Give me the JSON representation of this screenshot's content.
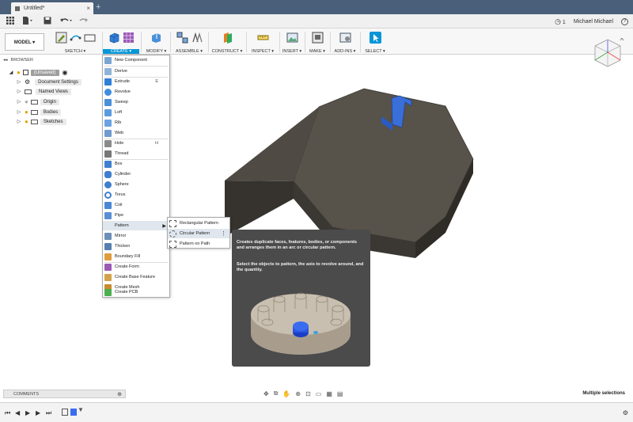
{
  "window": {
    "doc_tab": "Untitled*",
    "new_tab": "+"
  },
  "quickbar": {
    "jobs_count": "1",
    "user": "Michael Michael",
    "help": "?"
  },
  "ribbon": {
    "model": "MODEL ▾",
    "groups": [
      "SKETCH ▾",
      "CREATE ▾",
      "MODIFY ▾",
      "ASSEMBLE ▾",
      "CONSTRUCT ▾",
      "INSPECT ▾",
      "INSERT ▾",
      "MAKE ▾",
      "ADD-INS ▾",
      "SELECT ▾"
    ]
  },
  "browser": {
    "title": "BROWSER",
    "root": "(Unsaved)",
    "items": [
      "Document Settings",
      "Named Views",
      "Origin",
      "Bodies",
      "Sketches"
    ]
  },
  "create_menu": {
    "items": [
      {
        "label": "New Component",
        "shortcut": ""
      },
      {
        "label": "Derive",
        "shortcut": ""
      },
      {
        "label": "Extrude",
        "shortcut": "E"
      },
      {
        "label": "Revolve",
        "shortcut": ""
      },
      {
        "label": "Sweep",
        "shortcut": ""
      },
      {
        "label": "Loft",
        "shortcut": ""
      },
      {
        "label": "Rib",
        "shortcut": ""
      },
      {
        "label": "Web",
        "shortcut": ""
      },
      {
        "label": "Hole",
        "shortcut": "H"
      },
      {
        "label": "Thread",
        "shortcut": ""
      },
      {
        "label": "Box",
        "shortcut": ""
      },
      {
        "label": "Cylinder",
        "shortcut": ""
      },
      {
        "label": "Sphere",
        "shortcut": ""
      },
      {
        "label": "Torus",
        "shortcut": ""
      },
      {
        "label": "Coil",
        "shortcut": ""
      },
      {
        "label": "Pipe",
        "shortcut": ""
      },
      {
        "label": "Pattern",
        "shortcut": ""
      },
      {
        "label": "Mirror",
        "shortcut": ""
      },
      {
        "label": "Thicken",
        "shortcut": ""
      },
      {
        "label": "Boundary Fill",
        "shortcut": ""
      },
      {
        "label": "Create Form",
        "shortcut": ""
      },
      {
        "label": "Create Base Feature",
        "shortcut": ""
      },
      {
        "label": "Create Mesh",
        "shortcut": ""
      },
      {
        "label": "Create PCB",
        "shortcut": ""
      }
    ]
  },
  "pattern_submenu": {
    "items": [
      "Rectangular Pattern",
      "Circular Pattern",
      "Pattern on Path"
    ]
  },
  "tooltip": {
    "line1": "Creates duplicate faces, features, bodies, or components and arranges them in an arc or circular pattern.",
    "line2": "Select the objects to pattern, the axis to revolve around, and the quantity."
  },
  "comments": {
    "label": "COMMENTS"
  },
  "status": {
    "text": "Multiple selections"
  },
  "colors": {
    "accent": "#0696d7",
    "titlebar": "#4a5f7a",
    "model_top": "#565047",
    "model_side": "#3d3933",
    "tooltip_bg": "#4b4b4b"
  }
}
